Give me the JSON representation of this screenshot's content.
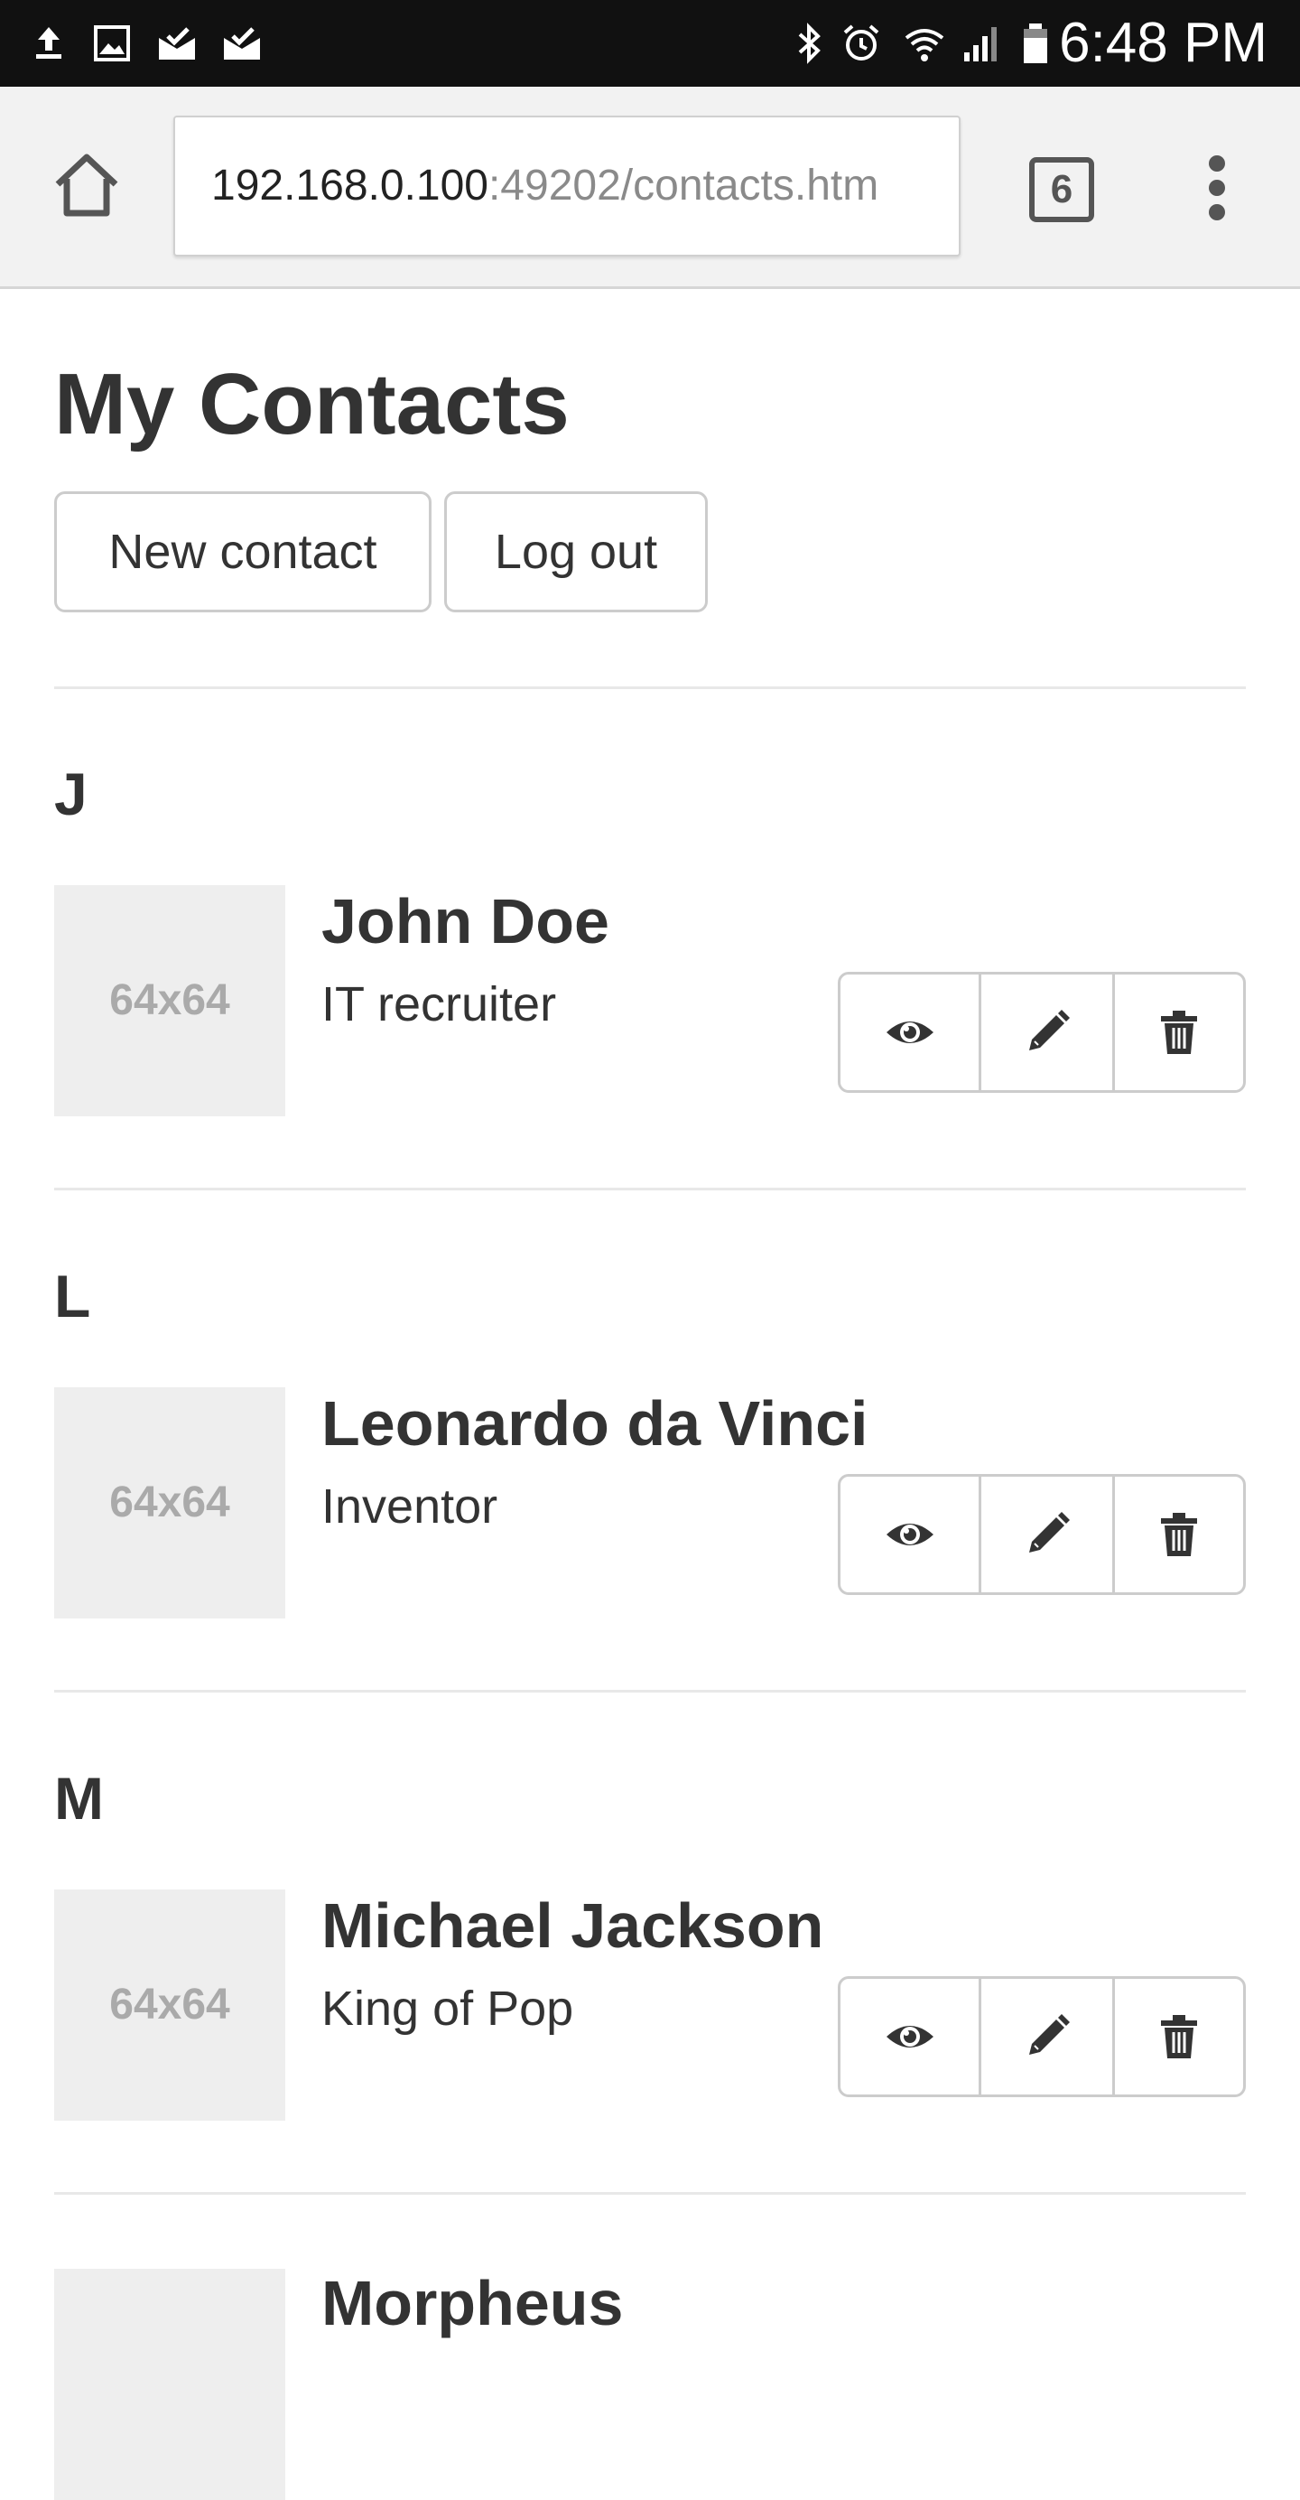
{
  "status_bar": {
    "time": "6:48 PM",
    "left_icons": [
      "upload-icon",
      "image-icon",
      "mail-check-icon",
      "mail-check-icon"
    ],
    "right_icons": [
      "bluetooth-icon",
      "alarm-icon",
      "wifi-icon",
      "signal-icon",
      "battery-icon"
    ]
  },
  "browser": {
    "url_host": "192.168.0.100",
    "url_path": ":49202/contacts.htm",
    "tab_count": "6"
  },
  "page": {
    "title": "My Contacts",
    "new_contact_label": "New contact",
    "logout_label": "Log out"
  },
  "groups": [
    {
      "letter": "J",
      "contacts": [
        {
          "thumb": "64x64",
          "name": "John Doe",
          "role": "IT recruiter"
        }
      ]
    },
    {
      "letter": "L",
      "contacts": [
        {
          "thumb": "64x64",
          "name": "Leonardo da Vinci",
          "role": "Inventor"
        }
      ]
    },
    {
      "letter": "M",
      "contacts": [
        {
          "thumb": "64x64",
          "name": "Michael Jackson",
          "role": "King of Pop"
        },
        {
          "thumb": "",
          "name": "Morpheus",
          "role": ""
        }
      ]
    }
  ],
  "icons": {
    "view": "eye-icon",
    "edit": "pencil-icon",
    "delete": "trash-icon"
  }
}
